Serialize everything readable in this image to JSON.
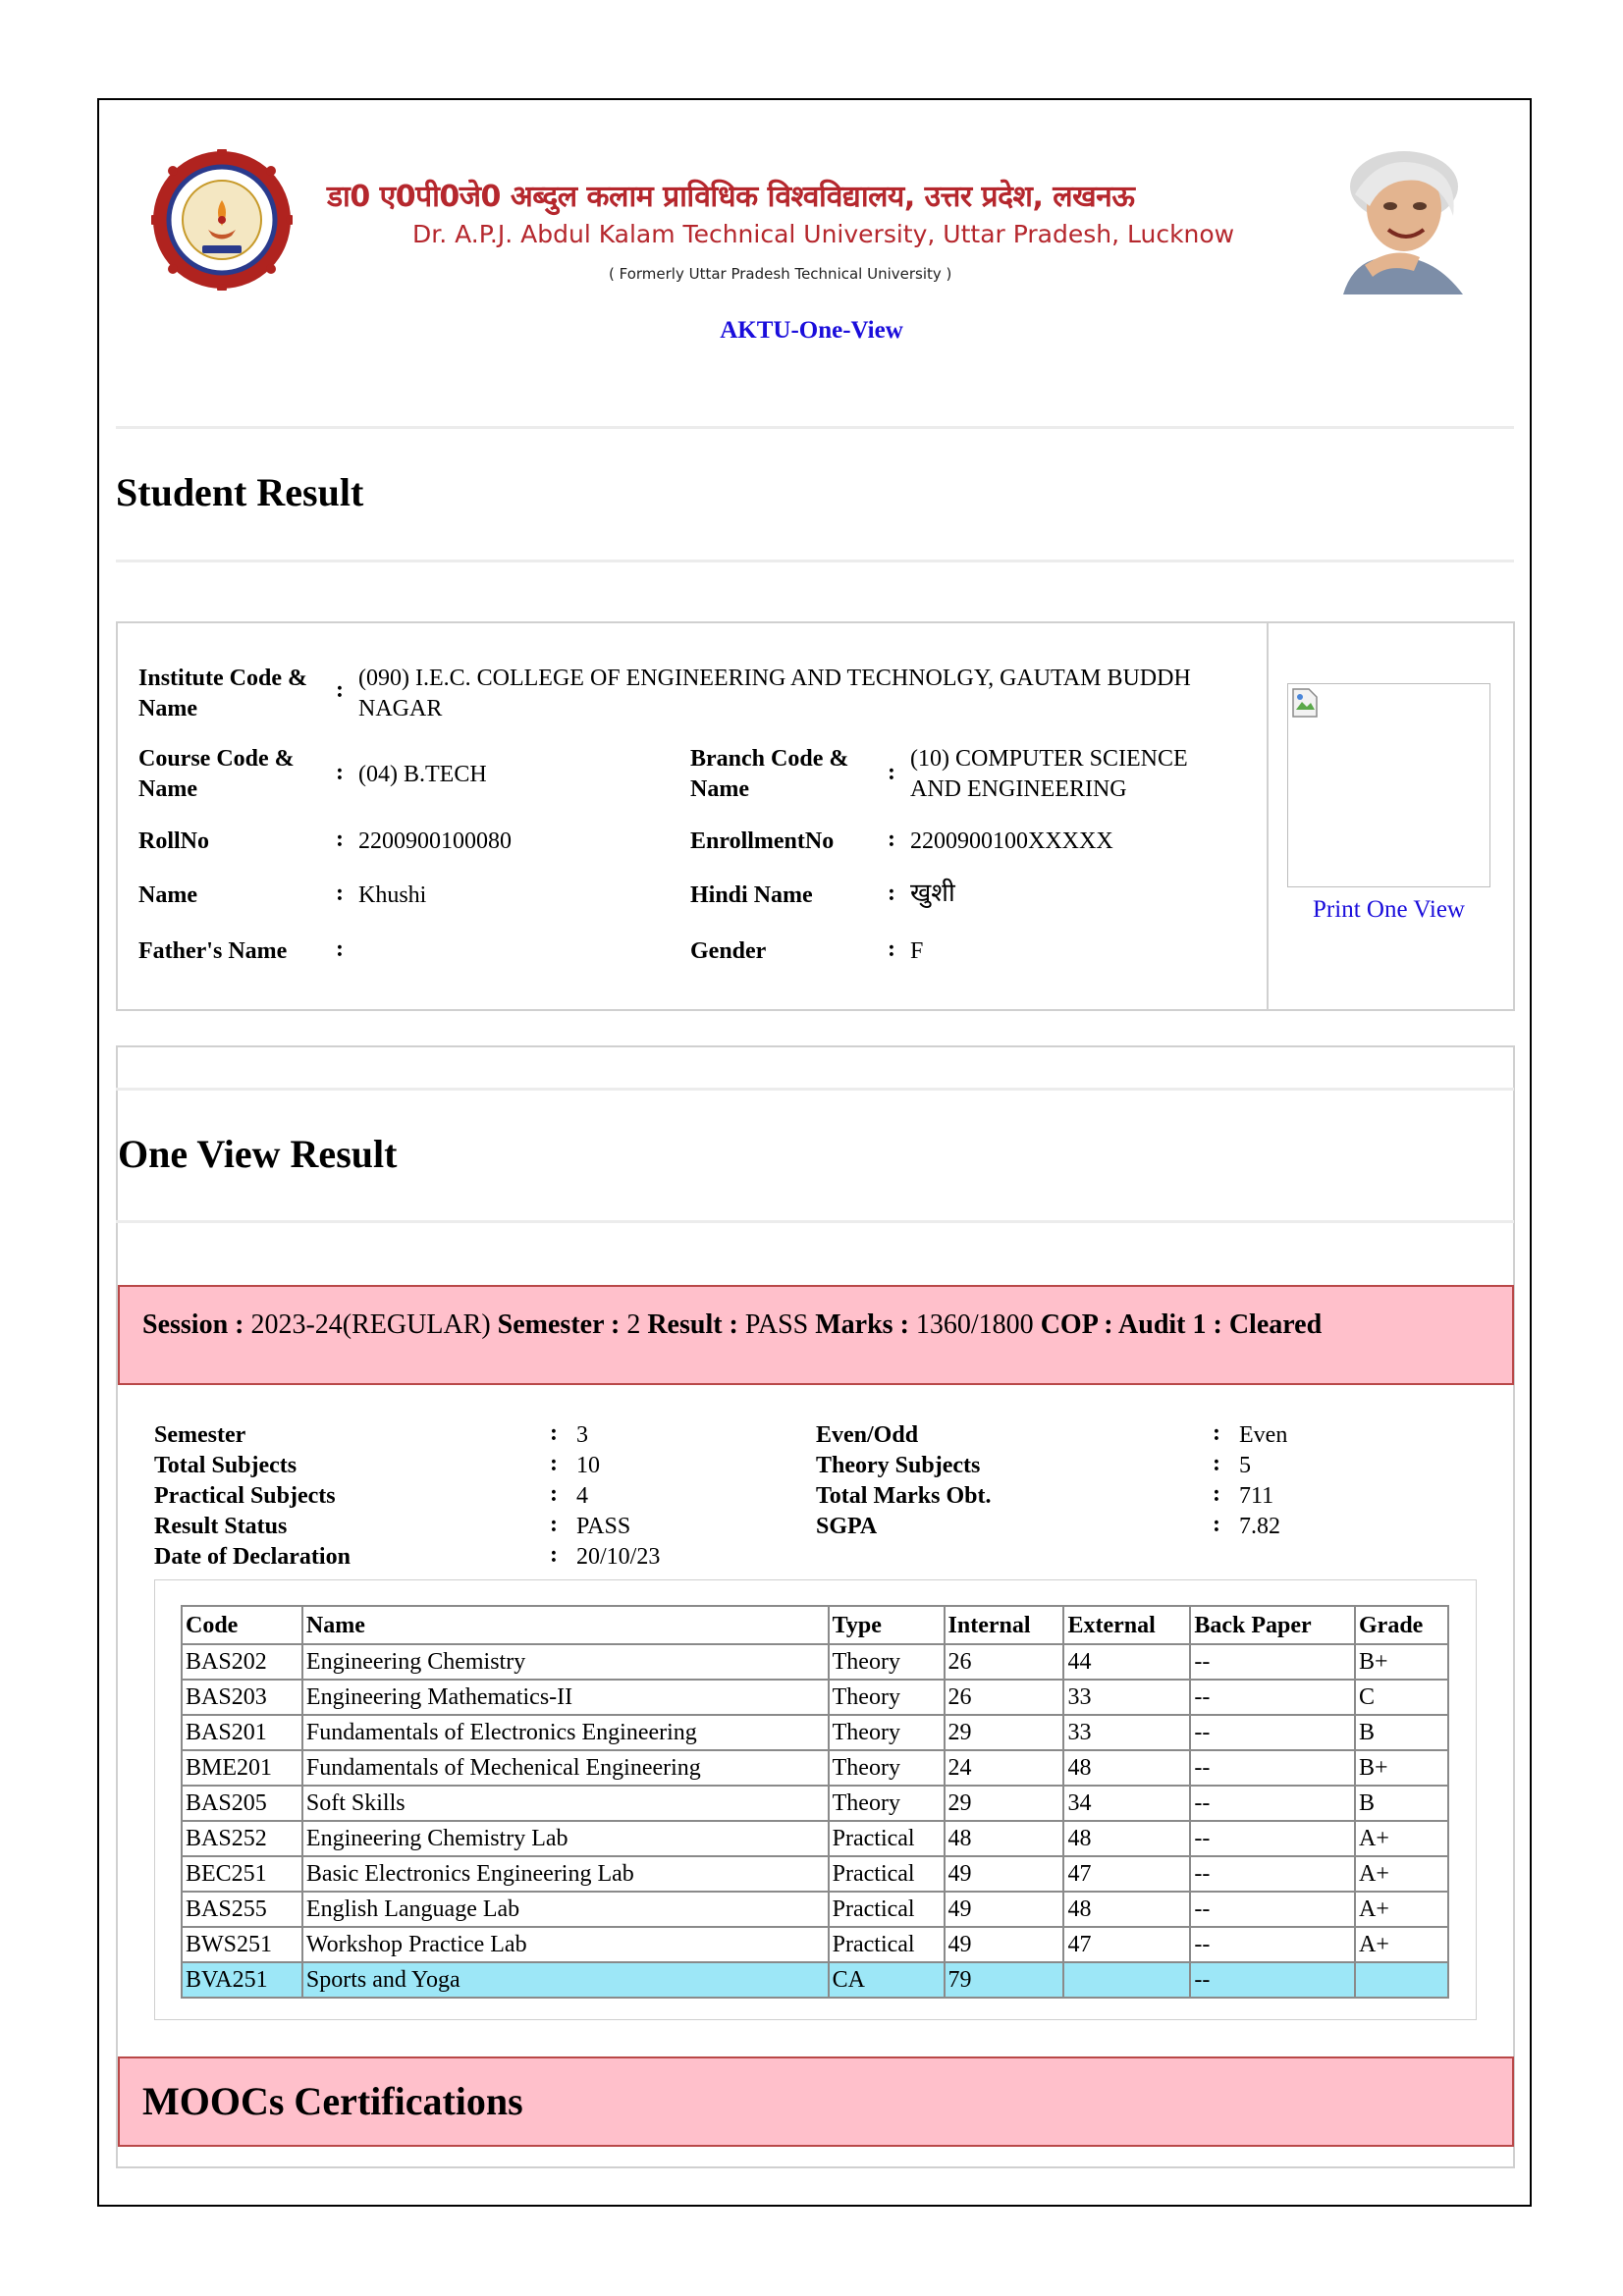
{
  "header": {
    "university_hindi": "डा0 ए0पी0जे0 अब्दुल कलाम प्राविधिक विश्वविद्यालय, उत्तर प्रदेश, लखनऊ",
    "university_english": "Dr. A.P.J. Abdul Kalam Technical University, Uttar Pradesh, Lucknow",
    "formerly": "( Formerly Uttar Pradesh Technical University )",
    "link": "AKTU-One-View",
    "logo_icon": "university-seal-icon",
    "portrait_icon": "portrait-photo-icon"
  },
  "page_title": "Student Result",
  "student": {
    "institute_label": "Institute Code & Name",
    "institute_value": "(090) I.E.C. COLLEGE OF ENGINEERING AND TECHNOLGY, GAUTAM BUDDH NAGAR",
    "course_label": "Course Code & Name",
    "course_value": "(04) B.TECH",
    "branch_label": "Branch Code & Name",
    "branch_value": "(10) COMPUTER SCIENCE AND ENGINEERING",
    "rollno_label": "RollNo",
    "rollno_value": "2200900100080",
    "enrollment_label": "EnrollmentNo",
    "enrollment_value": "2200900100XXXXX",
    "name_label": "Name",
    "name_value": "Khushi",
    "hindi_name_label": "Hindi Name",
    "hindi_name_value": "खुशी",
    "father_label": "Father's Name",
    "father_value": "",
    "gender_label": "Gender",
    "gender_value": "F",
    "colon": ":"
  },
  "photo": {
    "print_link": "Print One View",
    "photo_icon": "broken-image-icon"
  },
  "one_view_title": "One View Result",
  "session": {
    "session_label": "Session :",
    "session_value": "2023-24(REGULAR)",
    "semester_label": "Semester :",
    "semester_value": "2",
    "result_label": "Result :",
    "result_value": "PASS",
    "marks_label": "Marks :",
    "marks_value": "1360/1800",
    "cop_text": "COP : Audit 1 : Cleared"
  },
  "summary": {
    "semester_label": "Semester",
    "semester_value": "3",
    "total_subjects_label": "Total Subjects",
    "total_subjects_value": "10",
    "practical_label": "Practical Subjects",
    "practical_value": "4",
    "result_status_label": "Result Status",
    "result_status_value": "PASS",
    "declaration_label": "Date of Declaration",
    "declaration_value": "20/10/23",
    "even_odd_label": "Even/Odd",
    "even_odd_value": "Even",
    "theory_label": "Theory Subjects",
    "theory_value": "5",
    "total_marks_label": "Total Marks Obt.",
    "total_marks_value": "711",
    "sgpa_label": "SGPA",
    "sgpa_value": "7.82",
    "colon": ":"
  },
  "marks_table": {
    "headers": [
      "Code",
      "Name",
      "Type",
      "Internal",
      "External",
      "Back Paper",
      "Grade"
    ],
    "rows": [
      [
        "BAS202",
        "Engineering Chemistry",
        "Theory",
        "26",
        "44",
        "--",
        "B+"
      ],
      [
        "BAS203",
        "Engineering Mathematics-II",
        "Theory",
        "26",
        "33",
        "--",
        "C"
      ],
      [
        "BAS201",
        "Fundamentals of Electronics Engineering",
        "Theory",
        "29",
        "33",
        "--",
        "B"
      ],
      [
        "BME201",
        "Fundamentals of Mechenical Engineering",
        "Theory",
        "24",
        "48",
        "--",
        "B+"
      ],
      [
        "BAS205",
        "Soft Skills",
        "Theory",
        "29",
        "34",
        "--",
        "B"
      ],
      [
        "BAS252",
        "Engineering Chemistry Lab",
        "Practical",
        "48",
        "48",
        "--",
        "A+"
      ],
      [
        "BEC251",
        "Basic Electronics Engineering Lab",
        "Practical",
        "49",
        "47",
        "--",
        "A+"
      ],
      [
        "BAS255",
        "English Language Lab",
        "Practical",
        "49",
        "48",
        "--",
        "A+"
      ],
      [
        "BWS251",
        "Workshop Practice Lab",
        "Practical",
        "49",
        "47",
        "--",
        "A+"
      ],
      [
        "BVA251",
        "Sports and Yoga",
        "CA",
        "79",
        "",
        "--",
        ""
      ]
    ],
    "highlight_color": "#9de7f7"
  },
  "moocs_title": "MOOCs Certifications",
  "colors": {
    "pink_box": "#ffc0cb",
    "pink_border": "#b94848",
    "link_blue": "#1a0ddb",
    "brand_red": "#b5272d"
  }
}
